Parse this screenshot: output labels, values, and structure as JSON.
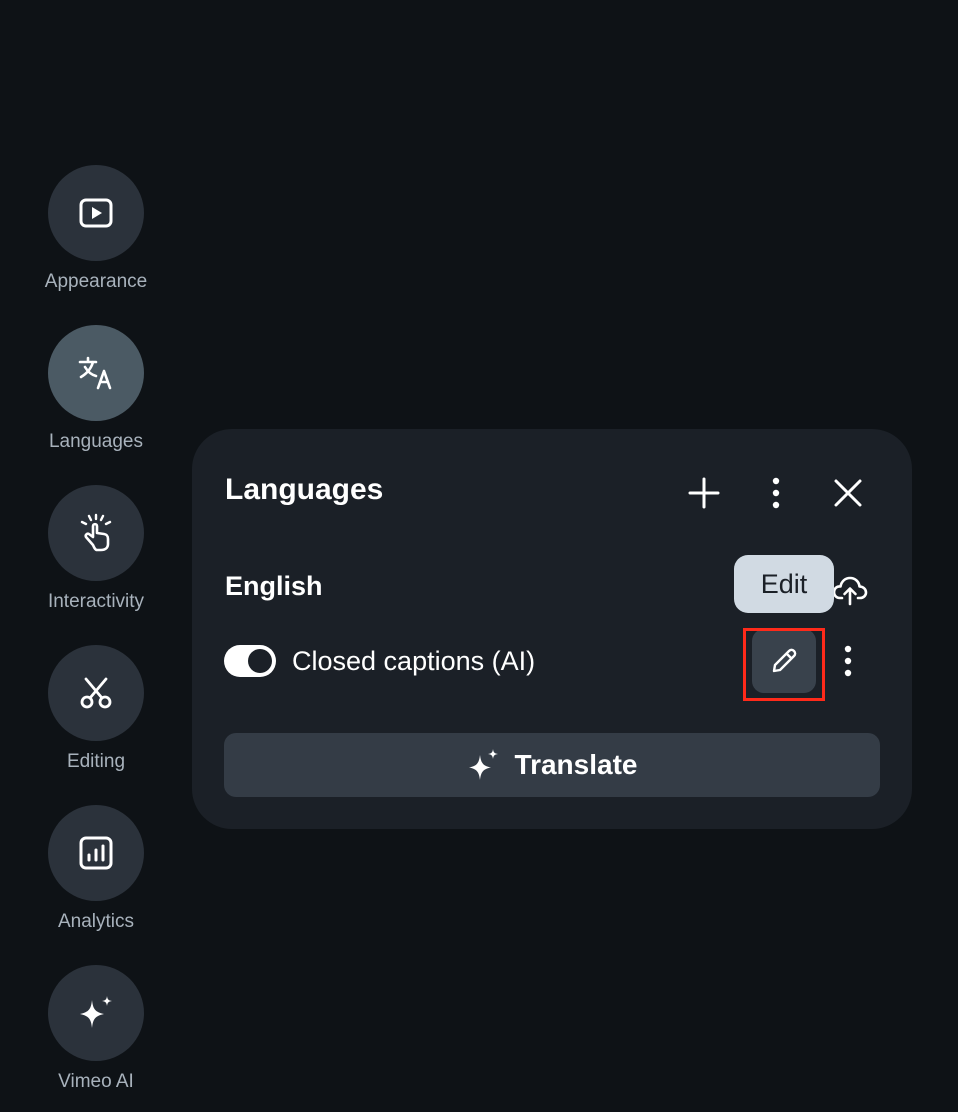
{
  "sidebar": {
    "items": [
      {
        "label": "Appearance",
        "icon": "play-video-icon",
        "active": false
      },
      {
        "label": "Languages",
        "icon": "translate-icon",
        "active": true
      },
      {
        "label": "Interactivity",
        "icon": "hand-tap-icon",
        "active": false
      },
      {
        "label": "Editing",
        "icon": "scissors-icon",
        "active": false
      },
      {
        "label": "Analytics",
        "icon": "bar-chart-icon",
        "active": false
      },
      {
        "label": "Vimeo AI",
        "icon": "sparkle-icon",
        "active": false
      }
    ]
  },
  "panel": {
    "title": "Languages",
    "header_icons": [
      "plus-icon",
      "more-vertical-icon",
      "close-icon"
    ],
    "language": {
      "name": "English",
      "tooltip": "Edit",
      "upload_icon": "cloud-upload-icon",
      "track": {
        "label": "Closed captions (AI)",
        "enabled": true
      }
    },
    "translate_label": "Translate"
  },
  "colors": {
    "background": "#0e1216",
    "panel": "#1b2027",
    "sidebar_circle": "#2b323b",
    "sidebar_active": "#4b5a64",
    "tooltip": "#d1dae3",
    "highlight": "#ff2a1a"
  }
}
